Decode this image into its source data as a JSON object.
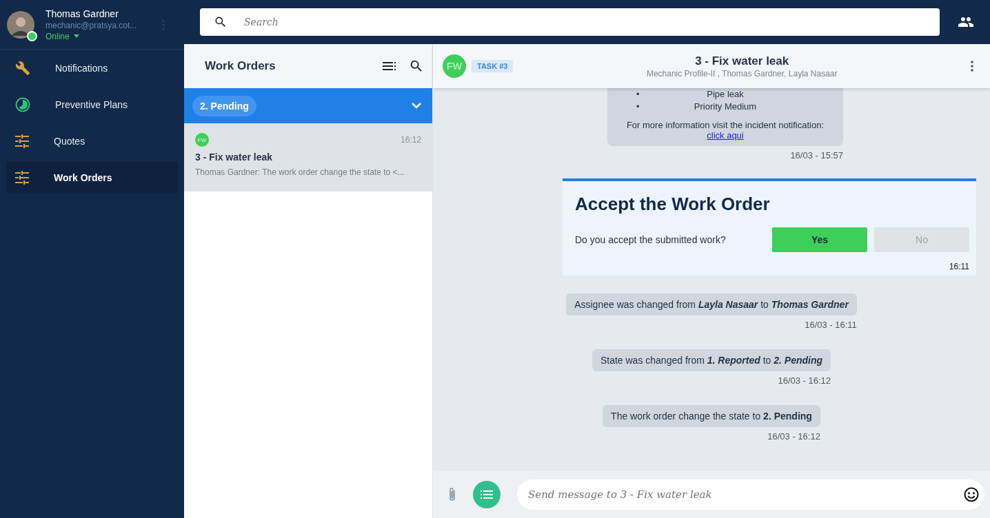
{
  "user": {
    "name": "Thomas Gardner",
    "email": "mechanic@pratsya.cot...",
    "status": "Online",
    "online": true
  },
  "nav": [
    {
      "label": "Notifications",
      "selected": false
    },
    {
      "label": "Preventive Plans",
      "selected": false
    },
    {
      "label": "Quotes",
      "selected": false
    },
    {
      "label": "Work Orders",
      "selected": true
    }
  ],
  "search": {
    "placeholder": "Search"
  },
  "list": {
    "title": "Work Orders",
    "group": "2. Pending",
    "group_expanded": true,
    "items": [
      {
        "avatar": "FW",
        "time": "16:12",
        "title": "3 - Fix water leak",
        "preview": "Thomas Gardner: The work order change the state to <...",
        "selected": true
      }
    ]
  },
  "chat": {
    "avatar": "FW",
    "tag": "TASK #3",
    "title": "3 - Fix water leak",
    "subtitle": "Mechanic Profile-II , Thomas Gardner, Layla Nasaar",
    "messages": [
      {
        "kind": "notification",
        "bullets": [
          {
            "marker": "•",
            "text": "Pipe leak"
          },
          {
            "marker": "•",
            "text": "Priority Medium"
          }
        ],
        "text": "For more information visit the incident notification:",
        "link": "click aqui",
        "time": "16/03 - 15:57"
      },
      {
        "kind": "prompt",
        "title": "Accept the Work Order",
        "question": "Do you accept the submitted work?",
        "buttons": [
          {
            "label": "Yes",
            "disabled": false
          },
          {
            "label": "No",
            "disabled": true
          }
        ],
        "time": "16:11"
      },
      {
        "kind": "event",
        "text": "Assignee was changed from *Layla Nasaar* to *Thomas Gardner*",
        "time": "16/03 - 16:11"
      },
      {
        "kind": "event",
        "text": "State was changed from *1. Reported* to *2. Pending*",
        "time": "16/03 - 16:12"
      },
      {
        "kind": "event",
        "text": "The work order change the state to **2. Pending**",
        "time": "16/03 - 16:12"
      }
    ],
    "composer": {
      "placeholder": "Send message to 3 - Fix water leak"
    }
  }
}
